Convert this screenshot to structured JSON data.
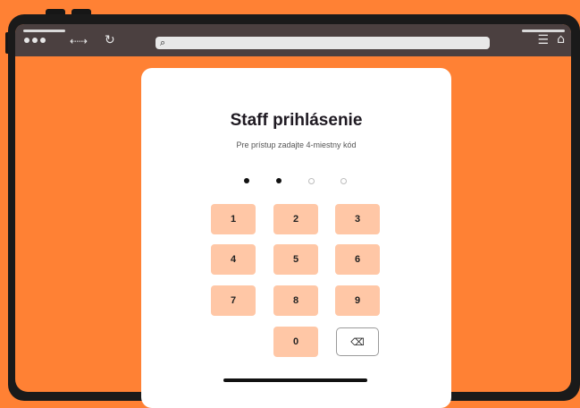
{
  "browser": {
    "nav_arrows": "⇠⇢",
    "reload_icon": "↻",
    "search_icon": "⌕",
    "menu_icon": "☰",
    "home_icon": "⌂"
  },
  "login": {
    "title": "Staff prihlásenie",
    "subtitle": "Pre prístup zadajte 4-miestny kód",
    "pin_length": 4,
    "pin_entered": 2
  },
  "keypad": {
    "keys": [
      "1",
      "2",
      "3",
      "4",
      "5",
      "6",
      "7",
      "8",
      "9",
      "0"
    ],
    "delete_label": "⌫"
  },
  "colors": {
    "background": "#ff8134",
    "key": "#ffc7a6",
    "toolbar": "#4b4040"
  }
}
